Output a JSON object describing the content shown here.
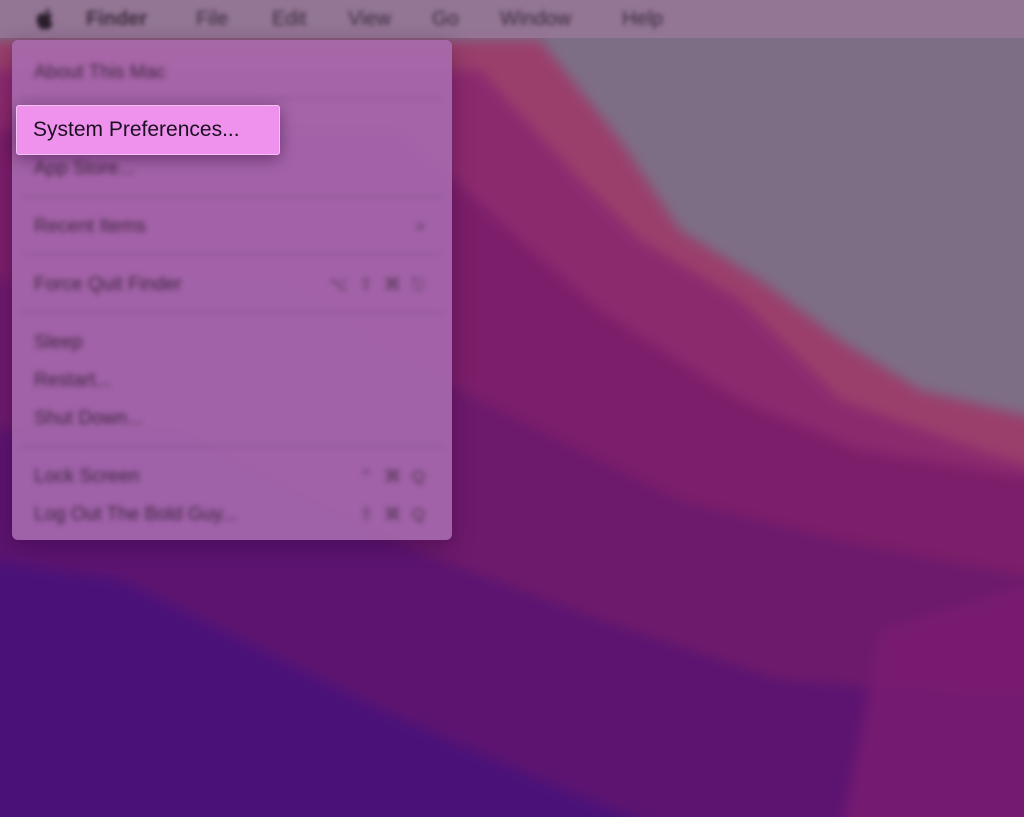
{
  "menubar": {
    "apple_icon": "apple-icon",
    "items": [
      "Finder",
      "File",
      "Edit",
      "View",
      "Go",
      "Window",
      "Help"
    ]
  },
  "apple_menu": {
    "items": [
      {
        "label": "About This Mac",
        "shortcut": ""
      },
      {
        "label": "System Preferences...",
        "shortcut": "",
        "highlighted": true
      },
      {
        "label": "App Store...",
        "shortcut": ""
      },
      {
        "label": "Recent Items",
        "shortcut": ">"
      },
      {
        "label": "Force Quit Finder",
        "shortcut": "⌥ ⇧ ⌘ ⎋"
      },
      {
        "label": "Sleep",
        "shortcut": ""
      },
      {
        "label": "Restart...",
        "shortcut": ""
      },
      {
        "label": "Shut Down...",
        "shortcut": ""
      },
      {
        "label": "Lock Screen",
        "shortcut": "⌃ ⌘ Q"
      },
      {
        "label": "Log Out The Bold Guy...",
        "shortcut": "⇧ ⌘ Q"
      }
    ]
  },
  "colors": {
    "highlight": "#ee92ee",
    "wallpaper_top": "#8a6f8a",
    "wallpaper_deep": "#4a1278"
  }
}
